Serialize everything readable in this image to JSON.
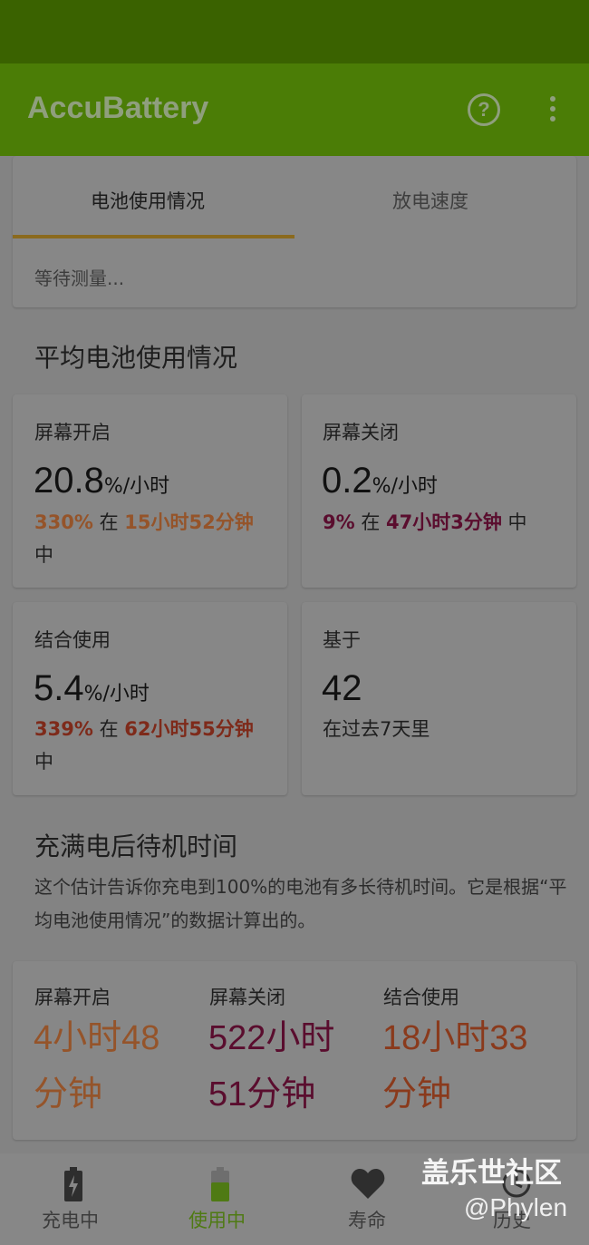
{
  "app": {
    "title": "AccuBattery"
  },
  "tabs": {
    "active": "电池使用情况",
    "inactive": "放电速度"
  },
  "status": {
    "waiting": "等待测量..."
  },
  "avg_usage": {
    "title": "平均电池使用情况",
    "screen_on": {
      "label": "屏幕开启",
      "value": "20.8",
      "unit": "%/小时",
      "percent": "330%",
      "in": " 在 ",
      "duration": "15小时52分钟",
      "suffix": " 中"
    },
    "screen_off": {
      "label": "屏幕关闭",
      "value": "0.2",
      "unit": "%/小时",
      "percent": "9%",
      "in": " 在 ",
      "duration": "47小时3分钟",
      "suffix": " 中"
    },
    "combined": {
      "label": "结合使用",
      "value": "5.4",
      "unit": "%/小时",
      "percent": "339%",
      "in": " 在 ",
      "duration": "62小时55分钟",
      "suffix": " 中"
    },
    "based_on": {
      "label": "基于",
      "value": "42",
      "detail": "在过去7天里"
    }
  },
  "standby": {
    "title": "充满电后待机时间",
    "description": "这个估计告诉你充电到100%的电池有多长待机时间。它是根据“平均电池使用情况”的数据计算出的。",
    "screen_on": {
      "label": "屏幕开启",
      "value": "4小时48分钟"
    },
    "screen_off": {
      "label": "屏幕关闭",
      "value": "522小时51分钟"
    },
    "combined": {
      "label": "结合使用",
      "value": "18小时33分钟"
    }
  },
  "nav": {
    "charging": "充电中",
    "discharging": "使用中",
    "health": "寿命",
    "history": "历史"
  },
  "watermark": {
    "line1": "盖乐世社区",
    "line2": "@Phylen"
  },
  "colors": {
    "status_bar": "#3a6200",
    "app_bar": "#4b7d06",
    "accent_tab": "#8b6a1e",
    "screen_on": "#95542a",
    "screen_off": "#5a0d2e",
    "combined": "#8a3a1c"
  }
}
